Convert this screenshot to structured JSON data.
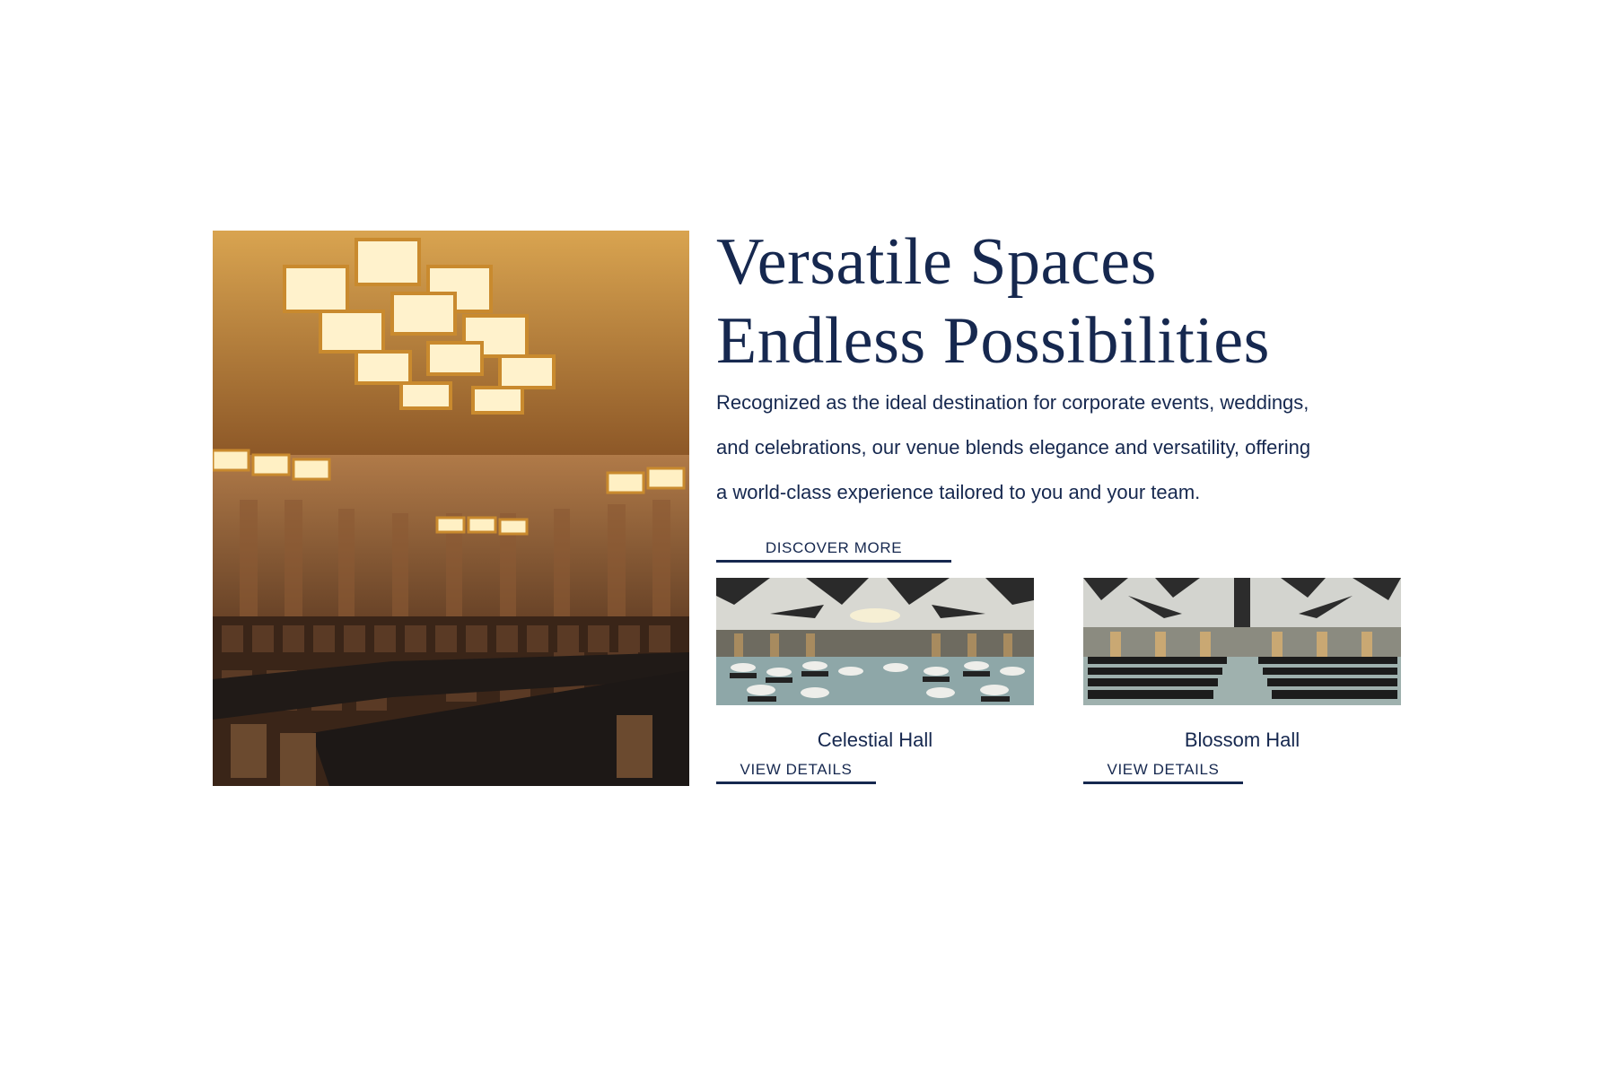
{
  "section": {
    "heading_line1": "Versatile Spaces",
    "heading_line2": "Endless Possibilities",
    "description_line1": "Recognized as the ideal destination for corporate events, weddings,",
    "description_line2": "and celebrations, our venue blends elegance and versatility, offering",
    "description_line3": "a world-class experience tailored to you and your team.",
    "discover_label": "DISCOVER MORE"
  },
  "halls": [
    {
      "name": "Celestial Hall",
      "cta": "VIEW DETAILS"
    },
    {
      "name": "Blossom Hall",
      "cta": "VIEW DETAILS"
    }
  ],
  "colors": {
    "primary": "#16284f",
    "background": "#ffffff"
  }
}
